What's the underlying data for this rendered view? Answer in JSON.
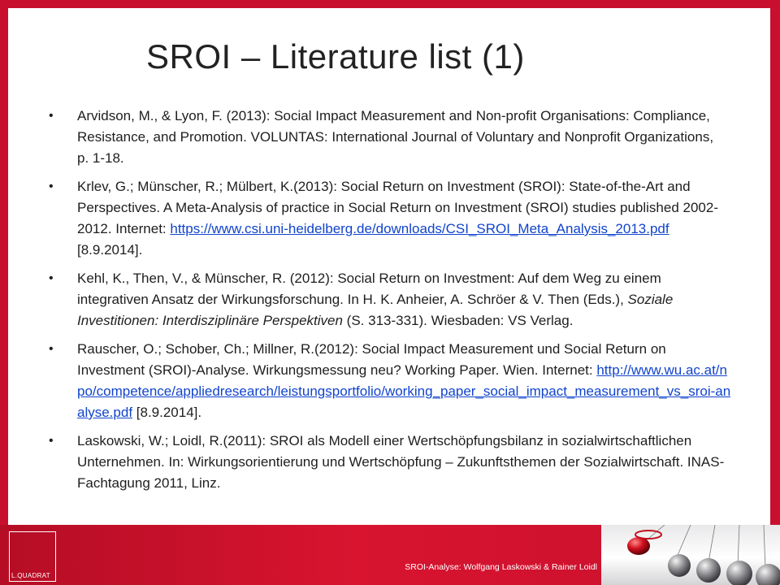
{
  "title": "SROI – Literature list (1)",
  "references": {
    "r1": {
      "text": "Arvidson, M., & Lyon, F. (2013): Social Impact Measurement and Non-profit Organisations: Compliance, Resistance, and Promotion. VOLUNTAS: International Journal of Voluntary and Nonprofit Organizations,",
      "pages": "p. 1-18."
    },
    "r2": {
      "text": "Krlev, G.; Münscher, R.; Mülbert, K.(2013): Social Return on Investment (SROI): State-of-the-Art and Perspectives. A Meta-Analysis of practice in Social Return on Investment (SROI) studies published 2002-2012. Internet: ",
      "link": "https://www.csi.uni-heidelberg.de/downloads/CSI_SROI_Meta_Analysis_2013.pdf",
      "after": " [8.9.2014]."
    },
    "r3": {
      "text": "Kehl, K., Then, V., & Münscher, R. (2012): Social Return on Investment: Auf dem Weg zu einem integrativen Ansatz der Wirkungsforschung. In H. K. Anheier, A. Schröer & V. Then (Eds.), ",
      "italic": "Soziale Investitionen: Interdisziplinäre Perspektiven",
      "after": " (S. 313-331). Wiesbaden: VS Verlag."
    },
    "r4": {
      "text": "Rauscher, O.; Schober, Ch.; Millner, R.(2012):  Social Impact Measurement und Social Return on Investment (SROI)-Analyse.  Wirkungsmessung neu? Working Paper. Wien. Internet: ",
      "link": "http://www.wu.ac.at/npo/competence/appliedresearch/leistungsportfolio/working_paper_social_impact_measurement_vs_sroi-analyse.pdf",
      "after": "  [8.9.2014]."
    },
    "r5": {
      "text": "Laskowski, W.; Loidl, R.(2011): SROI als Modell einer Wertschöpfungsbilanz in sozialwirtschaftlichen Unternehmen. In: Wirkungsorientierung und Wertschöpfung – Zukunftsthemen der Sozialwirtschaft. INAS-Fachtagung 2011, Linz."
    }
  },
  "footer": {
    "logo_text": "L.QUADRAT",
    "caption": "SROI-Analyse: Wolfgang Laskowski & Rainer Loidl"
  },
  "colors": {
    "background_red": "#c8102e",
    "link": "#1144cc"
  }
}
